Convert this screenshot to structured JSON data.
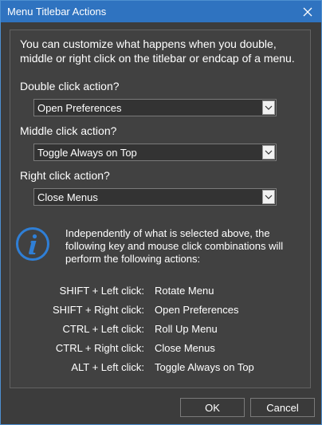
{
  "window": {
    "title": "Menu Titlebar Actions",
    "accent_color": "#2f73c0",
    "close_icon": "close-icon"
  },
  "intro_text": "You can customize what happens when you double, middle or right click on the titlebar or endcap of a menu.",
  "fields": [
    {
      "label": "Double click action?",
      "value": "Open Preferences"
    },
    {
      "label": "Middle click action?",
      "value": "Toggle Always on Top"
    },
    {
      "label": "Right click action?",
      "value": "Close Menus"
    }
  ],
  "info": {
    "icon": "info-icon",
    "text": "Independently of what is selected above, the following key and mouse click combinations will perform the following actions:"
  },
  "combos": [
    {
      "key": "SHIFT + Left click:",
      "action": "Rotate Menu"
    },
    {
      "key": "SHIFT + Right click:",
      "action": "Open Preferences"
    },
    {
      "key": "CTRL + Left click:",
      "action": "Roll Up Menu"
    },
    {
      "key": "CTRL + Right click:",
      "action": "Close Menus"
    },
    {
      "key": "ALT + Left click:",
      "action": "Toggle Always on Top"
    }
  ],
  "buttons": {
    "ok_label": "OK",
    "cancel_label": "Cancel"
  }
}
